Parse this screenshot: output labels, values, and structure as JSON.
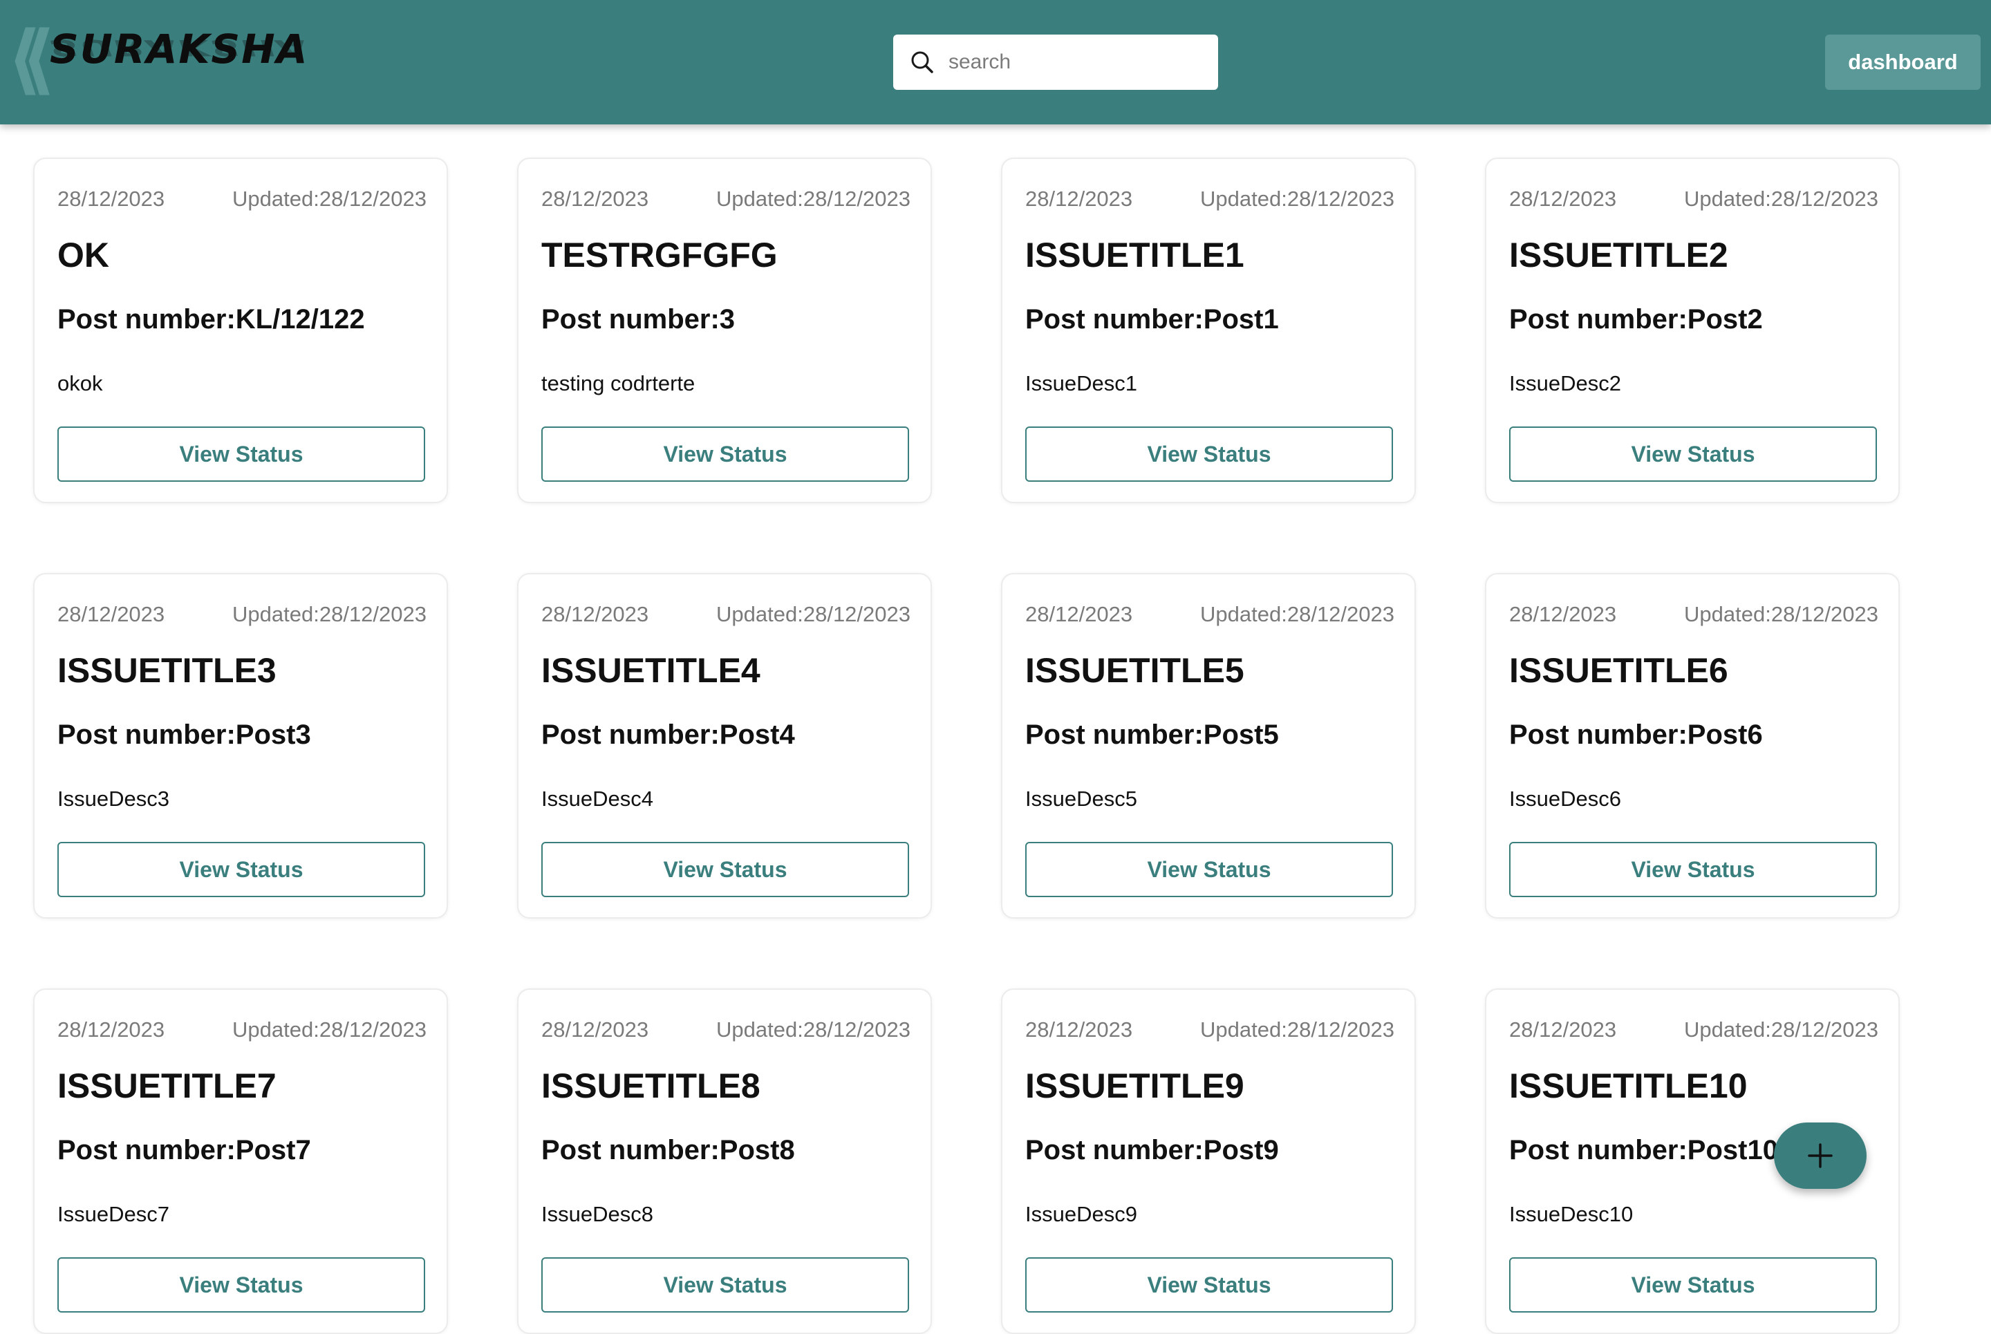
{
  "app": {
    "logo_text": "SURAKSHA"
  },
  "header": {
    "search_placeholder": "search",
    "search_value": "",
    "dashboard_label": "dashboard"
  },
  "colors": {
    "brand": "#3a7f7e",
    "dashboard_button": "#5a9998",
    "card_border": "#ececec"
  },
  "card_button_label": "View Status",
  "fab": {
    "icon": "plus-icon"
  },
  "issues": [
    {
      "date": "28/12/2023",
      "updated": "Updated:28/12/2023",
      "title": "OK",
      "post": "Post number:KL/12/122",
      "desc": "okok"
    },
    {
      "date": "28/12/2023",
      "updated": "Updated:28/12/2023",
      "title": "TESTRGFGFG",
      "post": "Post number:3",
      "desc": "testing codrterte"
    },
    {
      "date": "28/12/2023",
      "updated": "Updated:28/12/2023",
      "title": "ISSUETITLE1",
      "post": "Post number:Post1",
      "desc": "IssueDesc1"
    },
    {
      "date": "28/12/2023",
      "updated": "Updated:28/12/2023",
      "title": "ISSUETITLE2",
      "post": "Post number:Post2",
      "desc": "IssueDesc2"
    },
    {
      "date": "28/12/2023",
      "updated": "Updated:28/12/2023",
      "title": "ISSUETITLE3",
      "post": "Post number:Post3",
      "desc": "IssueDesc3"
    },
    {
      "date": "28/12/2023",
      "updated": "Updated:28/12/2023",
      "title": "ISSUETITLE4",
      "post": "Post number:Post4",
      "desc": "IssueDesc4"
    },
    {
      "date": "28/12/2023",
      "updated": "Updated:28/12/2023",
      "title": "ISSUETITLE5",
      "post": "Post number:Post5",
      "desc": "IssueDesc5"
    },
    {
      "date": "28/12/2023",
      "updated": "Updated:28/12/2023",
      "title": "ISSUETITLE6",
      "post": "Post number:Post6",
      "desc": "IssueDesc6"
    },
    {
      "date": "28/12/2023",
      "updated": "Updated:28/12/2023",
      "title": "ISSUETITLE7",
      "post": "Post number:Post7",
      "desc": "IssueDesc7"
    },
    {
      "date": "28/12/2023",
      "updated": "Updated:28/12/2023",
      "title": "ISSUETITLE8",
      "post": "Post number:Post8",
      "desc": "IssueDesc8"
    },
    {
      "date": "28/12/2023",
      "updated": "Updated:28/12/2023",
      "title": "ISSUETITLE9",
      "post": "Post number:Post9",
      "desc": "IssueDesc9"
    },
    {
      "date": "28/12/2023",
      "updated": "Updated:28/12/2023",
      "title": "ISSUETITLE10",
      "post": "Post number:Post10",
      "desc": "IssueDesc10"
    }
  ]
}
